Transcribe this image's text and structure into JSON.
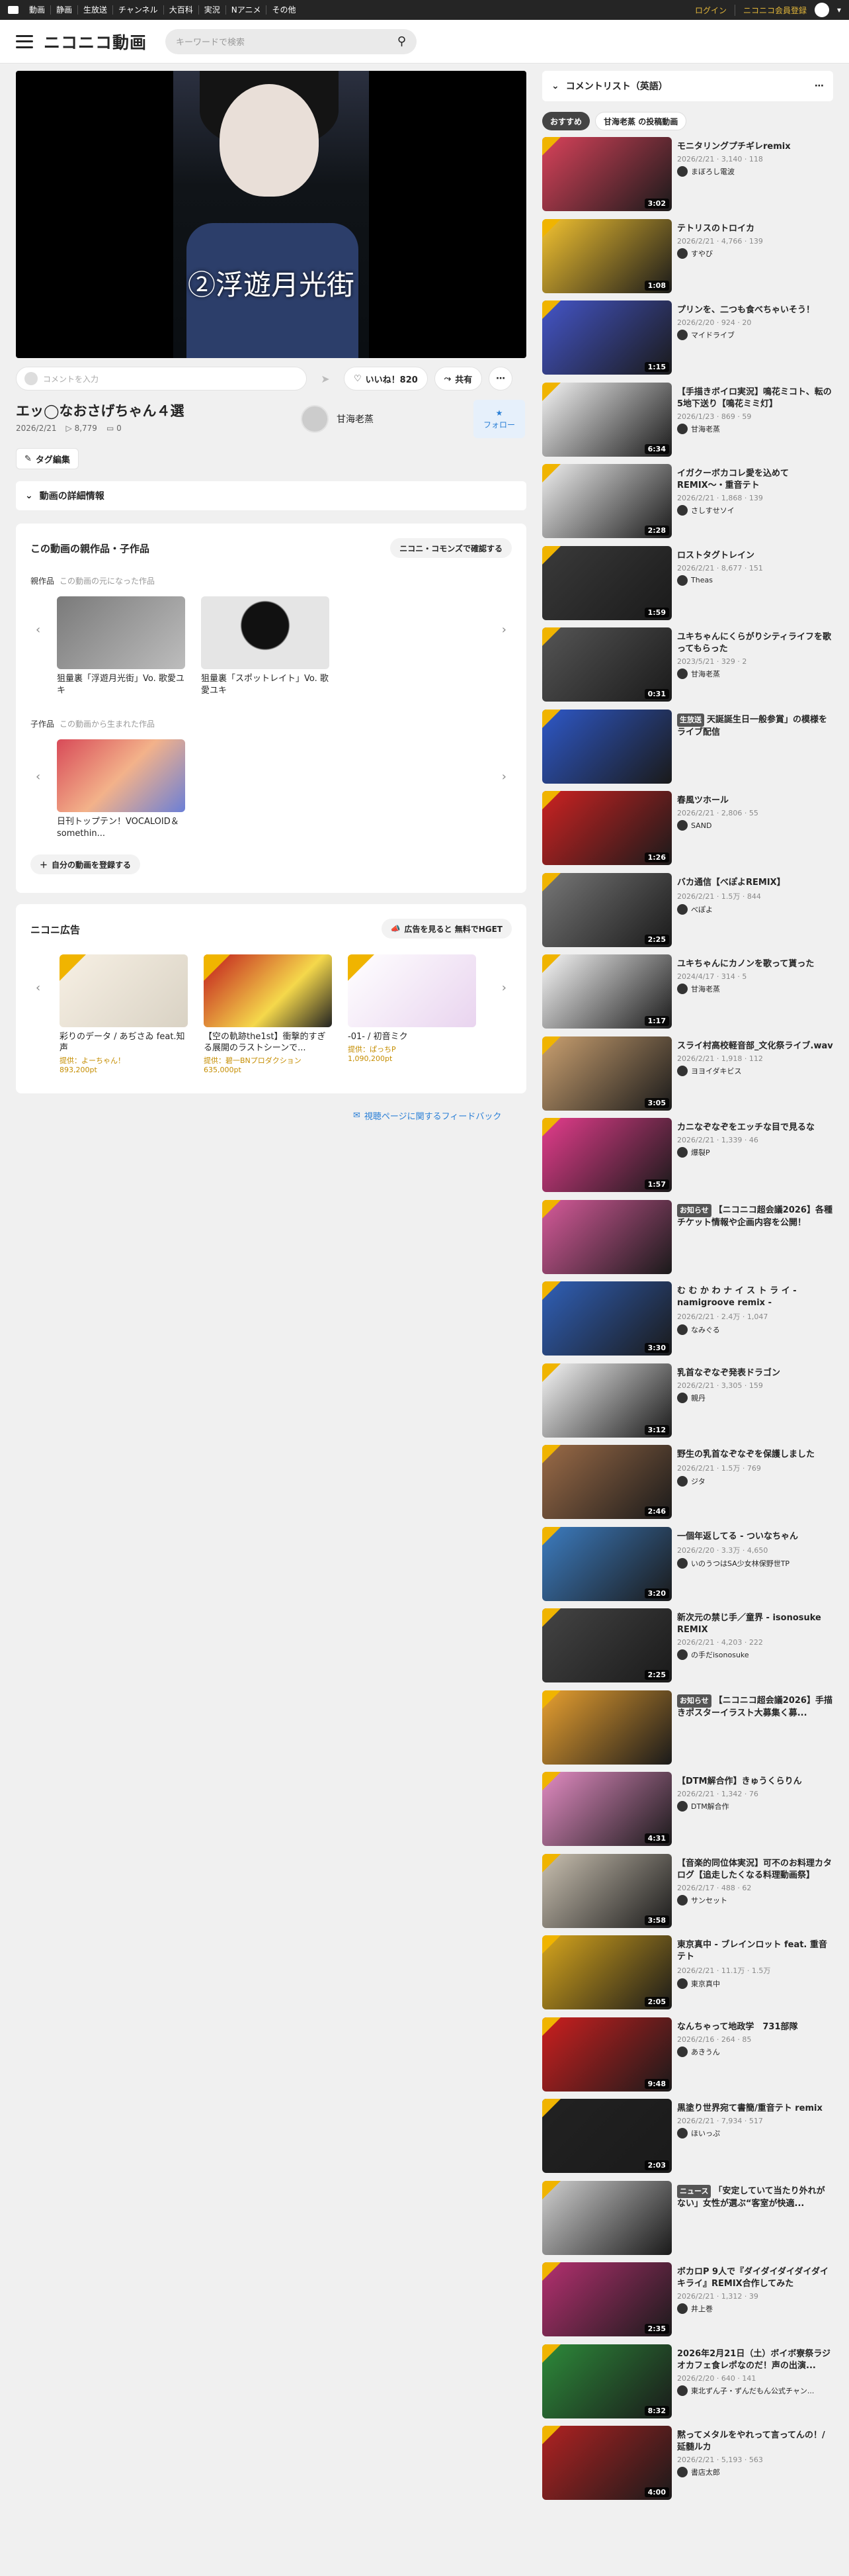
{
  "topbar": {
    "links": [
      "動画",
      "静画",
      "生放送",
      "チャンネル",
      "大百科",
      "実況",
      "Nアニメ",
      "その他"
    ],
    "login": "ログイン",
    "premium": "ニコニコ会員登録"
  },
  "header": {
    "brand": "ニコニコ動画",
    "search_placeholder": "キーワードで検索"
  },
  "player": {
    "overlay_text": "②浮遊月光街"
  },
  "commentbar": {
    "placeholder": "コメントを入力",
    "like_label": "いいね！820",
    "share_label": "共有"
  },
  "video": {
    "title": "エッ◯なおさげちゃん４選",
    "date": "2026/2/21",
    "views": "8,779",
    "comments": "0",
    "owner": "甘海老蒸",
    "follow": "フォロー"
  },
  "tag_edit": "タグ編集",
  "details": "動画の詳細情報",
  "works": {
    "title": "この動画の親作品・子作品",
    "confirm": "ニコニ・コモンズで確認する",
    "parent_label": "親作品",
    "parent_hint": "この動画の元になった作品",
    "parents": [
      {
        "title": "狙量裏「浮遊月光街」Vo. 歌愛ユキ"
      },
      {
        "title": "狙量裏「スポットレイト」Vo. 歌愛ユキ"
      }
    ],
    "child_label": "子作品",
    "child_hint": "この動画から生まれた作品",
    "children": [
      {
        "title": "日刊トップテン！VOCALOID＆somethin..."
      }
    ],
    "register": "自分の動画を登録する"
  },
  "ads": {
    "title": "ニコニ広告",
    "cta": "広告を見ると 無料でHGET",
    "items": [
      {
        "title": "彩りのデータ / あぢさゐ feat.知声",
        "ad1": "提供：よーちゃん！",
        "ad2": "893,200pt"
      },
      {
        "title": "【空の軌跡the1st】衝撃的すぎる展開のラストシーンで...",
        "ad1": "提供：碧一BNプロダクション",
        "ad2": "635,000pt"
      },
      {
        "title": "-01- / 初音ミク",
        "ad1": "提供：ぱっちP",
        "ad2": "1,090,200pt"
      }
    ]
  },
  "feedback": "視聴ページに関するフィードバック",
  "playlist": {
    "title": "コメントリスト（英語）",
    "tabs": [
      "おすすめ",
      "甘海老蒸 の投稿動画"
    ],
    "items": [
      {
        "title": "モニタリングプチギレremix",
        "meta": "2026/2/21 · 3,140 · 118",
        "owner": "まぼろし電波",
        "dur": "3:02"
      },
      {
        "title": "テトリスのトロイカ",
        "meta": "2026/2/21 · 4,766 · 139",
        "owner": "すやび",
        "dur": "1:08"
      },
      {
        "title": "プリンを、二つも食べちゃいそう！",
        "meta": "2026/2/20 · 924 · 20",
        "owner": "マイドライブ",
        "dur": "1:15"
      },
      {
        "title": "【手描きボイロ実況】鳴花ミコト、転の5地下送り【鳴花ミミ灯】",
        "meta": "2026/1/23 · 869 · 59",
        "owner": "甘海老蒸",
        "dur": "6:34"
      },
      {
        "title": "イガクーボカコレ愛を込めてREMIX〜・重音テト",
        "meta": "2026/2/21 · 1,868 · 139",
        "owner": "さしすせソイ",
        "dur": "2:28"
      },
      {
        "title": "ロストタグトレイン",
        "meta": "2026/2/21 · 8,677 · 151",
        "owner": "Theas",
        "dur": "1:59"
      },
      {
        "title": "ユキちゃんにくらがりシティライフを歌ってもらった",
        "meta": "2023/5/21 · 329 · 2",
        "owner": "甘海老蒸",
        "dur": "0:31"
      },
      {
        "title": "天誕誕生日一般参賞」の模様をライブ配信",
        "meta": "",
        "owner": "",
        "dur": "",
        "badge": "生放送"
      },
      {
        "title": "春風ツホール",
        "meta": "2026/2/21 · 2,806 · 55",
        "owner": "SAND",
        "dur": "1:26"
      },
      {
        "title": "バカ通信【べぽよREMIX】",
        "meta": "2026/2/21 · 1.5万 · 844",
        "owner": "べぽよ",
        "dur": "2:25"
      },
      {
        "title": "ユキちゃんにカノンを歌って貰った",
        "meta": "2024/4/17 · 314 · 5",
        "owner": "甘海老蒸",
        "dur": "1:17"
      },
      {
        "title": "スライ村高校軽音部_文化祭ライブ.wav",
        "meta": "2026/2/21 · 1,918 · 112",
        "owner": "ヨヨイダキビス",
        "dur": "3:05"
      },
      {
        "title": "カニなぞなぞをエッチな目で見るな",
        "meta": "2026/2/21 · 1,339 · 46",
        "owner": "爆裂P",
        "dur": "1:57"
      },
      {
        "title": "【ニコニコ超会議2026】各種チケット情報や企画内容を公開！",
        "meta": "",
        "owner": "",
        "dur": "",
        "badge": "お知らせ"
      },
      {
        "title": "む む か わ ナ イ ス ト ラ イ - namigroove remix -",
        "meta": "2026/2/21 · 2.4万 · 1,047",
        "owner": "なみぐる",
        "dur": "3:30"
      },
      {
        "title": "乳首なぞなぞ発表ドラゴン",
        "meta": "2026/2/21 · 3,305 · 159",
        "owner": "親丹",
        "dur": "3:12"
      },
      {
        "title": "野生の乳首なぞなぞを保護しました",
        "meta": "2026/2/21 · 1.5万 · 769",
        "owner": "ジタ",
        "dur": "2:46"
      },
      {
        "title": "一個年返してる - ついなちゃん",
        "meta": "2026/2/20 · 3.3万 · 4,650",
        "owner": "いのうつはSA少女林保野世TP",
        "dur": "3:20"
      },
      {
        "title": "新次元の禁じ手／童界 - isonosuke REMIX",
        "meta": "2026/2/21 · 4,203 · 222",
        "owner": "の手だisonosuke",
        "dur": "2:25"
      },
      {
        "title": "【ニコニコ超会議2026】手描きポスターイラスト大募集く募...",
        "meta": "",
        "owner": "",
        "dur": "",
        "badge": "お知らせ"
      },
      {
        "title": "【DTM解合作】きゅうくらりん",
        "meta": "2026/2/21 · 1,342 · 76",
        "owner": "DTM解合作",
        "dur": "4:31"
      },
      {
        "title": "【音楽的同位体実況】可不のお料理カタログ【追走したくなる料理動画祭】",
        "meta": "2026/2/17 · 488 · 62",
        "owner": "サンセット",
        "dur": "3:58"
      },
      {
        "title": "東京真中 - ブレインロット feat. 重音テト",
        "meta": "2026/2/21 · 11.1万 · 1.5万",
        "owner": "東京真中",
        "dur": "2:05"
      },
      {
        "title": "なんちゃって地政学　731部隊",
        "meta": "2026/2/16 · 264 · 85",
        "owner": "あきうん",
        "dur": "9:48"
      },
      {
        "title": "黒塗り世界宛て書簡/重音テト remix",
        "meta": "2026/2/21 · 7,934 · 517",
        "owner": "ほいっぷ",
        "dur": "2:03"
      },
      {
        "title": "「安定していて当たり外れがない」女性が選ぶ“客室が快適...",
        "meta": "",
        "owner": "",
        "dur": "",
        "badge": "ニュース"
      },
      {
        "title": "ボカロP 9人で『ダイダイダイダイダイキライ』REMIX合作してみた",
        "meta": "2026/2/21 · 1,312 · 39",
        "owner": "井上巻",
        "dur": "2:35"
      },
      {
        "title": "2026年2月21日（土）ボイボ寮祭ラジオカフェ食レポなのだ！声の出演...",
        "meta": "2026/2/20 · 640 · 141",
        "owner": "東北ずん子・ずんだもん公式チャン...",
        "dur": "8:32"
      },
      {
        "title": "黙ってメタルをやれって言ってんの！/ 延髄ルカ",
        "meta": "2026/2/21 · 5,193 · 563",
        "owner": "書店太郎",
        "dur": "4:00"
      }
    ]
  }
}
